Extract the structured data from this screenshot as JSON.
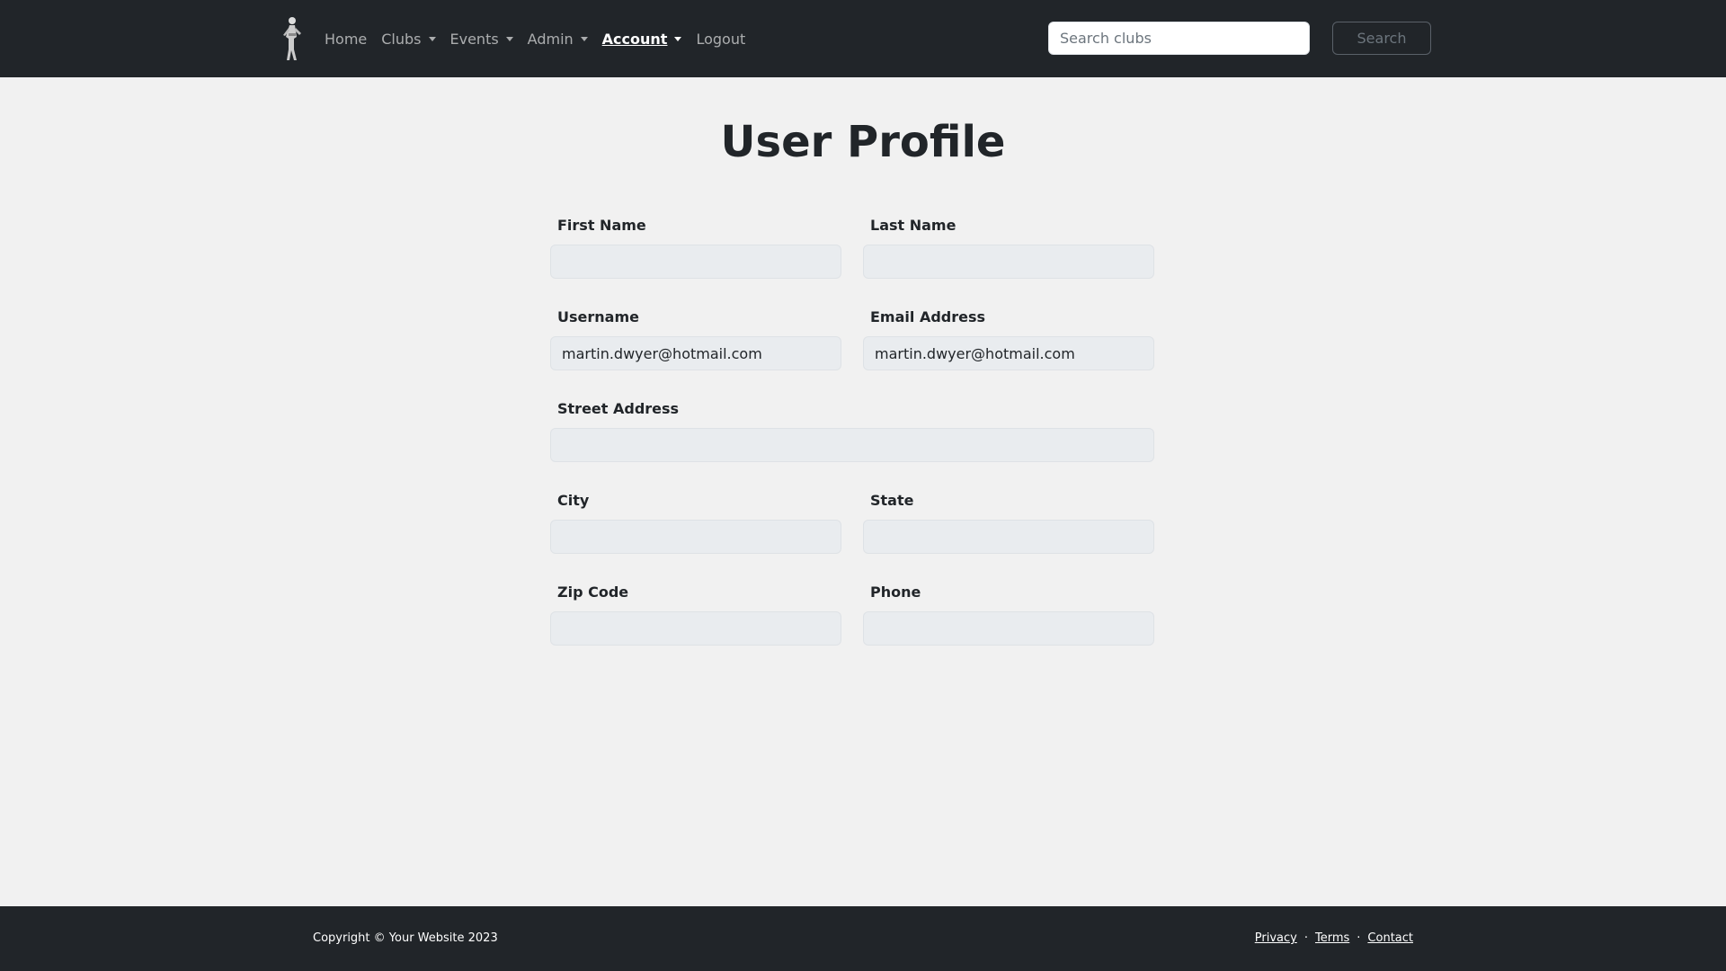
{
  "nav": {
    "logo_icon": "running-figure-logo-icon",
    "links": [
      {
        "label": "Home"
      },
      {
        "label": "Clubs"
      },
      {
        "label": "Events"
      },
      {
        "label": "Admin"
      },
      {
        "label": "Account"
      },
      {
        "label": "Logout"
      }
    ],
    "search_placeholder": "Search clubs",
    "search_button": "Search"
  },
  "main": {
    "title": "User Profile",
    "fields": {
      "first_name": {
        "label": "First Name",
        "value": ""
      },
      "last_name": {
        "label": "Last Name",
        "value": ""
      },
      "username": {
        "label": "Username",
        "value": "martin.dwyer@hotmail.com"
      },
      "email": {
        "label": "Email Address",
        "value": "martin.dwyer@hotmail.com"
      },
      "street": {
        "label": "Street Address",
        "value": ""
      },
      "city": {
        "label": "City",
        "value": ""
      },
      "state": {
        "label": "State",
        "value": ""
      },
      "zip": {
        "label": "Zip Code",
        "value": ""
      },
      "phone": {
        "label": "Phone",
        "value": ""
      }
    }
  },
  "footer": {
    "copyright": "Copyright © Your Website 2023",
    "links": [
      {
        "label": "Privacy"
      },
      {
        "label": "Terms"
      },
      {
        "label": "Contact"
      }
    ],
    "separator": "·"
  },
  "colors": {
    "navbar_bg": "#212529",
    "page_bg": "#f1f1f1",
    "input_bg": "#e9ecef"
  }
}
